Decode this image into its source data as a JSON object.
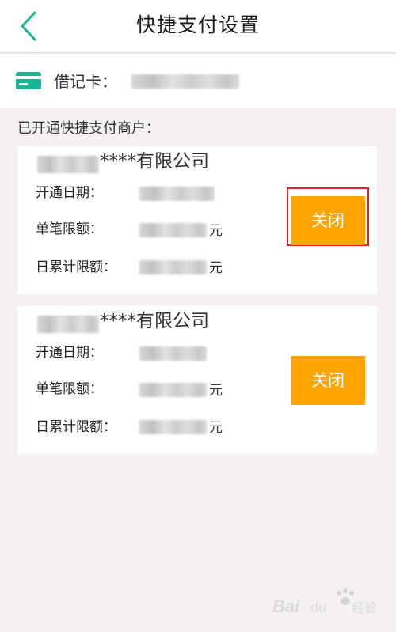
{
  "header": {
    "title": "快捷支付设置",
    "back_icon": "chevron-left-icon"
  },
  "card": {
    "icon": "card-icon",
    "label": "借记卡：",
    "color": "#1ab394"
  },
  "section": {
    "title": "已开通快捷支付商户："
  },
  "merchants": [
    {
      "name_suffix": "****有限公司",
      "date_label": "开通日期：",
      "single_limit_label": "单笔限额：",
      "daily_limit_label": "日累计限额：",
      "unit": "元",
      "close_label": "关闭",
      "highlighted": true
    },
    {
      "name_suffix": "****有限公司",
      "date_label": "开通日期：",
      "single_limit_label": "单笔限额：",
      "daily_limit_label": "日累计限额：",
      "unit": "元",
      "close_label": "关闭",
      "highlighted": false
    }
  ],
  "colors": {
    "accent": "#ffa500",
    "highlight_border": "#e0242b",
    "back_arrow": "#1ab394"
  }
}
